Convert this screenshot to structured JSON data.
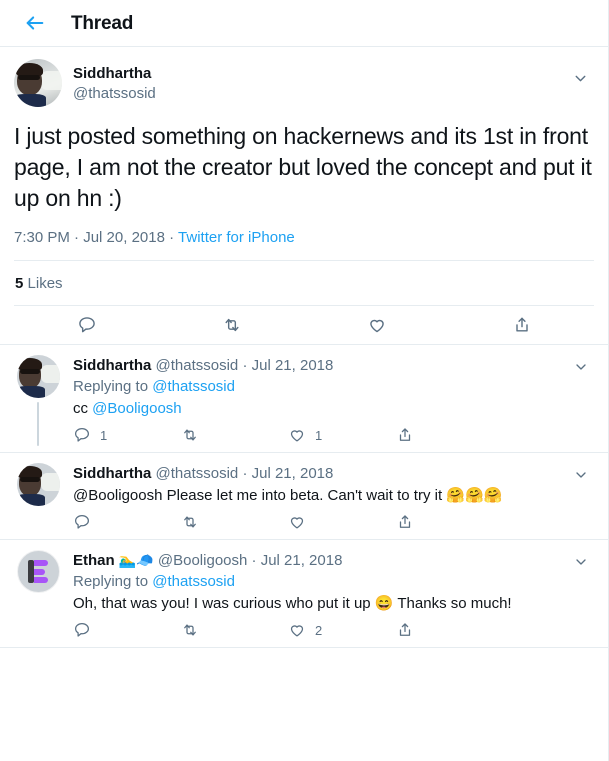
{
  "header": {
    "back_icon": "back-arrow-icon",
    "title": "Thread",
    "accent_color": "#1DA1F2"
  },
  "main_tweet": {
    "author_name": "Siddhartha",
    "author_handle": "@thatssosid",
    "avatar": "photo-avatar",
    "caret_icon": "chevron-down-icon",
    "text": "I just posted something on hackernews and its 1st in front page, I am not the creator but loved the concept and put it up on hn :)",
    "time": "7:30 PM",
    "separator1": "·",
    "date": "Jul 20, 2018",
    "separator2": "·",
    "source": "Twitter for iPhone",
    "likes_count": "5",
    "likes_label": "Likes",
    "actions": [
      {
        "name": "reply",
        "icon": "reply-icon",
        "count": ""
      },
      {
        "name": "retweet",
        "icon": "retweet-icon",
        "count": ""
      },
      {
        "name": "like",
        "icon": "heart-icon",
        "count": ""
      },
      {
        "name": "share",
        "icon": "share-icon",
        "count": ""
      }
    ]
  },
  "replies": [
    {
      "author_name": "Siddhartha",
      "name_emoji": "",
      "author_handle": "@thatssosid",
      "dot": "·",
      "date": "Jul 21, 2018",
      "avatar": "photo-avatar",
      "caret_icon": "chevron-down-icon",
      "replying_label": "Replying to",
      "replying_to": "@thatssosid",
      "text_prefix": "cc ",
      "text_mention": "@Booligoosh",
      "text_suffix": "",
      "has_thread_line": true,
      "actions": [
        {
          "name": "reply",
          "icon": "reply-icon",
          "count": "1"
        },
        {
          "name": "retweet",
          "icon": "retweet-icon",
          "count": ""
        },
        {
          "name": "like",
          "icon": "heart-icon",
          "count": "1"
        },
        {
          "name": "share",
          "icon": "share-icon",
          "count": ""
        }
      ]
    },
    {
      "author_name": "Siddhartha",
      "name_emoji": "",
      "author_handle": "@thatssosid",
      "dot": "·",
      "date": "Jul 21, 2018",
      "avatar": "photo-avatar",
      "caret_icon": "chevron-down-icon",
      "replying_label": "",
      "replying_to": "",
      "text_prefix": "@Booligoosh Please let me into beta. Can't wait to try it ",
      "text_mention": "",
      "text_suffix": "🤗🤗🤗",
      "has_thread_line": false,
      "actions": [
        {
          "name": "reply",
          "icon": "reply-icon",
          "count": ""
        },
        {
          "name": "retweet",
          "icon": "retweet-icon",
          "count": ""
        },
        {
          "name": "like",
          "icon": "heart-icon",
          "count": ""
        },
        {
          "name": "share",
          "icon": "share-icon",
          "count": ""
        }
      ]
    },
    {
      "author_name": "Ethan",
      "name_emoji": "🏊‍♂️🧢",
      "author_handle": "@Booligoosh",
      "dot": "·",
      "date": "Jul 21, 2018",
      "avatar": "logo-avatar",
      "caret_icon": "chevron-down-icon",
      "replying_label": "Replying to",
      "replying_to": "@thatssosid",
      "text_prefix": "Oh, that was you! I was curious who put it up 😄 Thanks so much!",
      "text_mention": "",
      "text_suffix": "",
      "has_thread_line": false,
      "actions": [
        {
          "name": "reply",
          "icon": "reply-icon",
          "count": ""
        },
        {
          "name": "retweet",
          "icon": "retweet-icon",
          "count": ""
        },
        {
          "name": "like",
          "icon": "heart-icon",
          "count": "2"
        },
        {
          "name": "share",
          "icon": "share-icon",
          "count": ""
        }
      ]
    }
  ],
  "colors": {
    "link": "#1DA1F2",
    "muted": "#5B7083",
    "text": "#0F1419",
    "border": "#E6ECF0",
    "icon": "#5B7083"
  }
}
